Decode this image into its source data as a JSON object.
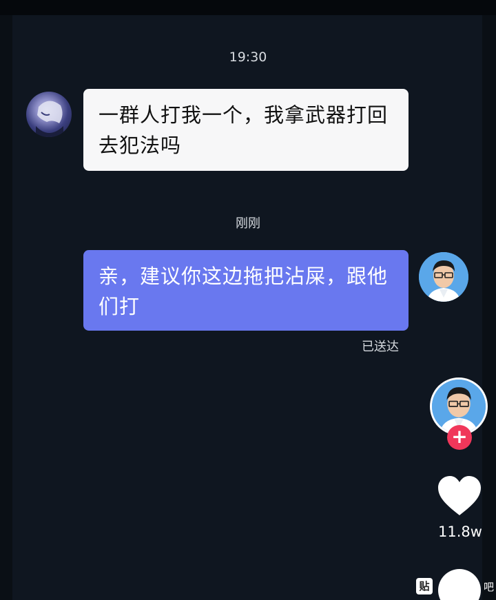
{
  "chat": {
    "timestamp_1": "19:30",
    "incoming_message": "一群人打我一个，我拿武器打回去犯法吗",
    "timestamp_2": "刚刚",
    "outgoing_message": "亲，建议你这边拖把沾屎，跟他们打",
    "delivery_status": "已送达"
  },
  "side_actions": {
    "follow_symbol": "+",
    "like_icon": "heart-icon",
    "like_count": "11.8w"
  },
  "watermark": {
    "logo": "贴",
    "text": "吧"
  },
  "colors": {
    "background": "#0f1620",
    "incoming_bubble": "#f7f7f8",
    "outgoing_bubble": "#6978ef",
    "follow_button": "#f0375a",
    "avatar_bg": "#5aa7e9"
  }
}
